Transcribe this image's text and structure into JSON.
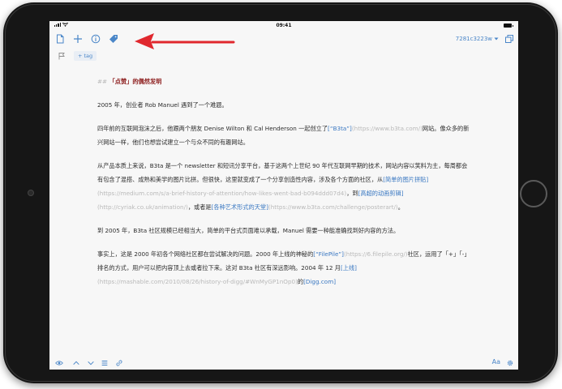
{
  "status_bar": {
    "time": "09:41"
  },
  "toolbar": {
    "version": "7281c3223w"
  },
  "tags": {
    "add_tag_label": "+ tag"
  },
  "editor": {
    "heading_md": "##",
    "heading_text": "「点赞」的偶然发明",
    "p1": "2005 年，创业者 Rob Manuel 遇到了一个难题。",
    "p2_a": "四年前的互联网泡沫之后，他跟两个朋友 Denise Wilton 和 Cal Henderson 一起创立了",
    "p2_link": "[“B3ta”]",
    "p2_url": "(https://www.b3ta.com/)",
    "p2_b": "网站。像众多的新兴网站一样，他们也想尝试建立一个与众不同的有趣网站。",
    "p3_a": "从产品本质上来说，B3ta 是一个 newsletter 和短讯分享平台，基于这两个上世纪 90 年代互联网早期的技术，网站内容以笑料为主，每周都会有包含了混搭、成熟和美学的图片比拼。但很快，这里就变成了一个分享创造性内容，涉及各个方面的社区，从",
    "p3_link1": "[简单的图片拼贴]",
    "p3_url1": "(https://medium.com/s/a-brief-history-of-attention/how-likes-went-bad-b094ddd07d4)",
    "p3_b": "，到",
    "p3_link2": "[高超的动画剪辑]",
    "p3_url2": "(http://cyriak.co.uk/animation/)",
    "p3_c": "，或者是",
    "p3_link3": "[各种艺术形式的天堂]",
    "p3_url3": "(https://www.b3ta.com/challenge/posterart/)",
    "p3_d": "。",
    "p4": "到 2005 年，B3ta 社区规模已经相当大，简单的平台式页面难以承载，Manuel 需要一种能准确找到好内容的方法。",
    "p5_a": "事实上，这是 2000 年初各个网络社区都在尝试解决的问题。2000 年上线的神秘的",
    "p5_link1": "[“FilePile”]",
    "p5_url1": "(https://6.filepile.org/)",
    "p5_b": "社区，运用了「+」「-」排名的方式，用户可以把内容顶上去或者拉下来。这对 B3ta 社区有深远影响。2004 年 12 月",
    "p5_link2": "[上线]",
    "p5_url2": "(https://mashable.com/2010/08/26/history-of-digg/#WnMyGP1nOp0)",
    "p5_c": "的",
    "p5_link3": "[Digg.com]"
  },
  "bottom_bar": {
    "font_label": "Aa"
  },
  "colors": {
    "accent": "#4a86c8",
    "heading": "#8b1a1a",
    "annotation_arrow": "#e0282e"
  }
}
